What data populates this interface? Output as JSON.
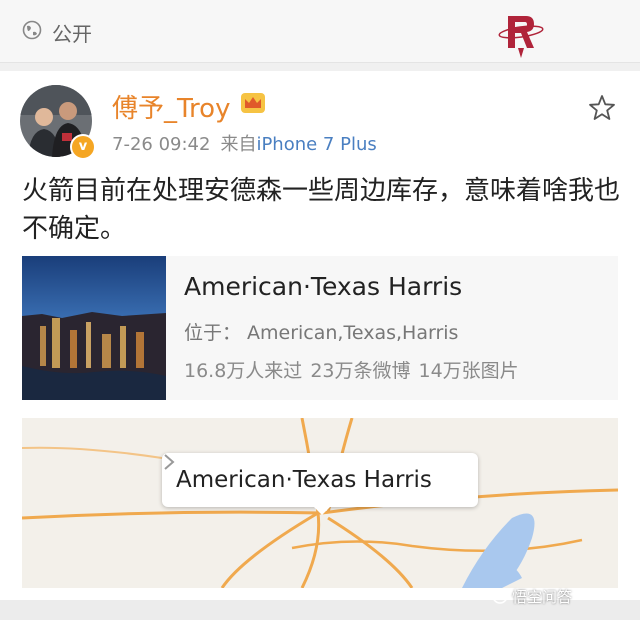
{
  "header": {
    "visibility_icon": "globe-icon",
    "visibility_label": "公开",
    "team_logo": "rockets-logo"
  },
  "post": {
    "author": {
      "name": "傅予_Troy",
      "badge_icon": "crown-icon",
      "verified_icon": "verified-v-icon",
      "verified_mark": "v"
    },
    "time": "7-26 09:42",
    "source_prefix": "来自",
    "device": "iPhone 7 Plus",
    "favorite_icon": "star-icon",
    "text": "火箭目前在处理安德森一些周边库存，意味着啥我也不确定。"
  },
  "place_card": {
    "name": "American·Texas Harris",
    "location_label": "位于：",
    "location_value": "American,Texas,Harris",
    "stats": [
      "16.8万人来过",
      "23万条微博",
      "14万张图片"
    ]
  },
  "map": {
    "label": "American·Texas Harris",
    "chevron_icon": "chevron-right-icon"
  },
  "watermark": {
    "text": "悟空问答",
    "icon": "wukong-icon"
  },
  "colors": {
    "username": "#e8842a",
    "device": "#4a7fc1",
    "verified": "#f5a623",
    "road": "#f0a94e",
    "water": "#a9c8ee"
  }
}
